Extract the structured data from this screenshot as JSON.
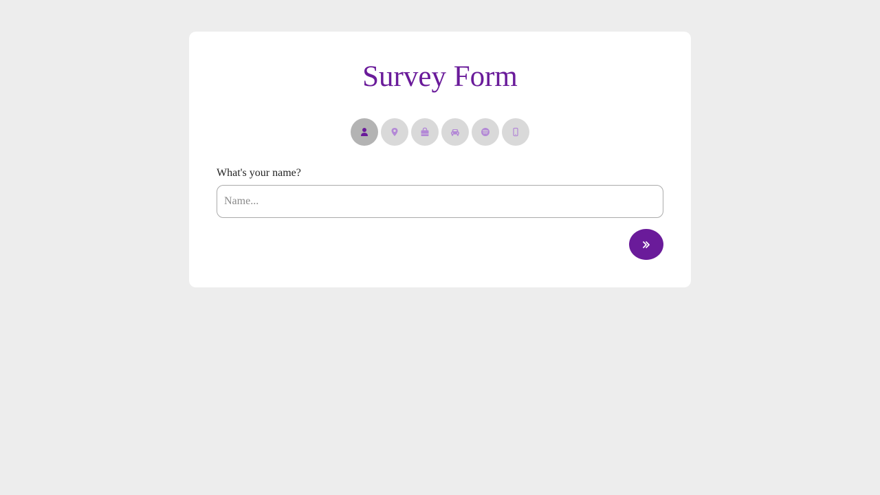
{
  "form": {
    "title": "Survey Form",
    "steps": [
      {
        "icon": "user-icon",
        "active": true
      },
      {
        "icon": "map-marker-icon",
        "active": false
      },
      {
        "icon": "shopping-bag-icon",
        "active": false
      },
      {
        "icon": "car-icon",
        "active": false
      },
      {
        "icon": "spotify-icon",
        "active": false
      },
      {
        "icon": "mobile-phone-icon",
        "active": false
      }
    ],
    "question_label": "What's your name?",
    "name_input": {
      "placeholder": "Name...",
      "value": ""
    },
    "next_button": {
      "icon": "double-chevron-right-icon"
    }
  },
  "colors": {
    "accent": "#6a1b9a",
    "inactive_icon": "#b388d6",
    "step_bg": "#d9d9d9",
    "step_active_bg": "#b3b3b3",
    "page_bg": "#ededed"
  }
}
